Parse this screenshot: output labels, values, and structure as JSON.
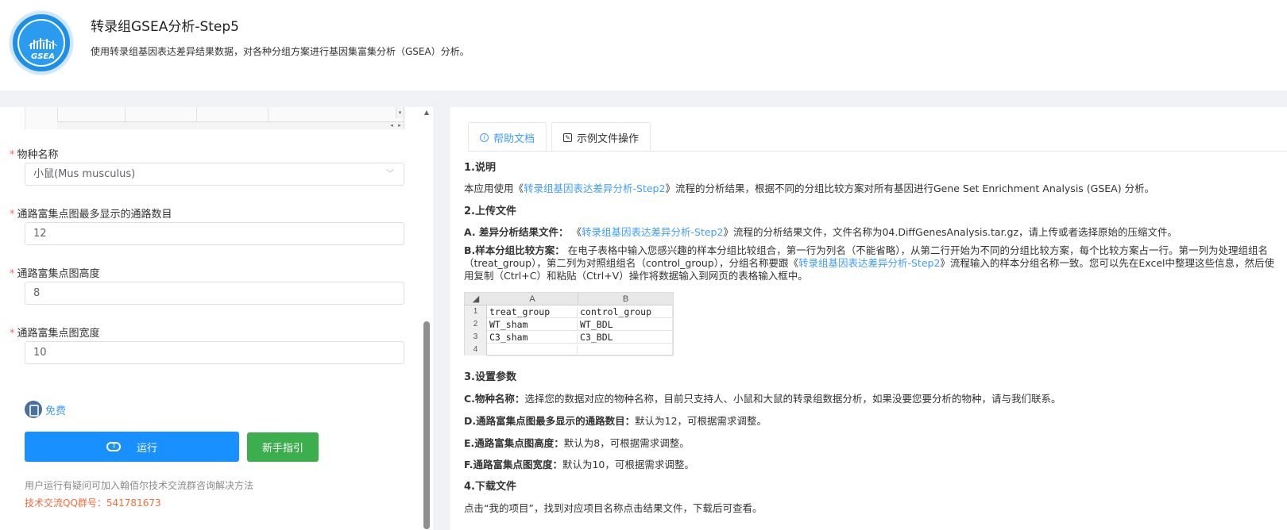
{
  "header": {
    "logo_text": "GSEA",
    "title": "转录组GSEA分析-Step5",
    "description": "使用转录组基因表达差异结果数据，对各种分组方案进行基因集富集分析（GSEA）分析。"
  },
  "form": {
    "required_mark": "*",
    "species": {
      "label": "物种名称",
      "value": "小鼠(Mus musculus)"
    },
    "max_pathways": {
      "label": "通路富集点图最多显示的通路数目",
      "value": "12"
    },
    "height": {
      "label": "通路富集点图高度",
      "value": "8"
    },
    "width": {
      "label": "通路富集点图宽度",
      "value": "10"
    },
    "free_label": "免费",
    "run_label": "运行",
    "guide_label": "新手指引",
    "tip_line1": "用户运行有疑问可加入翰佰尔技术交流群咨询解决方法",
    "tip_line2": "技术交流QQ群号：541781673"
  },
  "tabs": [
    {
      "label": "帮助文档",
      "icon": "help-circle-icon"
    },
    {
      "label": "示例文件操作",
      "icon": "file-edit-icon"
    }
  ],
  "doc": {
    "s1_title": "1.说明",
    "s1_pre": "本应用使用《",
    "s1_link": "转录组基因表达差异分析-Step2",
    "s1_post": "》流程的分析结果，根据不同的分组比较方案对所有基因进行Gene Set Enrichment Analysis (GSEA) 分析。",
    "s2_title": "2.上传文件",
    "a_label": "A.  差异分析结果文件：",
    "a_pre": " 《",
    "a_link": "转录组基因表达差异分析-Step2",
    "a_post": "》流程的分析结果文件，文件名称为04.DiffGenesAnalysis.tar.gz，请上传或者选择原始的压缩文件。",
    "b_label": "B.样本分组比较方案：",
    "b_pre": " 在电子表格中输入您感兴趣的样本分组比较组合，第一行为列名（不能省略），从第二行开始为不同的分组比较方案，每个比较方案占一行。第一列为处理组组名（treat_group），第二列为对照组组名（control_group），分组名称要跟《",
    "b_link": "转录组基因表达差异分析-Step2",
    "b_post": "》流程输入的样本分组名称一致。您可以先在Excel中整理这些信息，然后使用复制（Ctrl+C）和粘贴（Ctrl+V）操作将数据输入到网页的表格输入框中。",
    "s3_title": "3.设置参数",
    "c_label": "C.物种名称：",
    "c_text": "选择您的数据对应的物种名称，目前只支持人、小鼠和大鼠的转录组数据分析，如果没要您要分析的物种，请与我们联系。",
    "d_label": "D.通路富集点图最多显示的通路数目：",
    "d_text": "默认为12，可根据需求调整。",
    "e_label": "E.通路富集点图高度：",
    "e_text": "默认为8，可根据需求调整。",
    "f_label": "F.通路富集点图宽度：",
    "f_text": "默认为10，可根据需求调整。",
    "s4_title": "4.下载文件",
    "s4_text": "点击“我的项目”，找到对应项目名称点击结果文件，下载后可查看。"
  },
  "example_sheet": {
    "col_headers": [
      "A",
      "B"
    ],
    "row_numbers": [
      "1",
      "2",
      "3",
      "4"
    ],
    "rows": [
      [
        "treat_group",
        "control_group"
      ],
      [
        "WT_sham",
        "WT_BDL"
      ],
      [
        "C3_sham",
        "C3_BDL"
      ],
      [
        "",
        ""
      ]
    ]
  }
}
